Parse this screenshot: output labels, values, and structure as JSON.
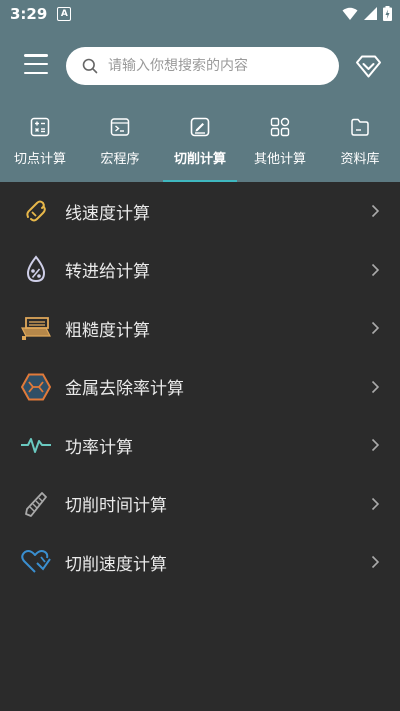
{
  "status": {
    "time": "3:29",
    "notification": "A"
  },
  "search": {
    "placeholder": "请输入你想搜索的内容"
  },
  "tabs": [
    {
      "label": "切点计算",
      "icon": "calculator-icon"
    },
    {
      "label": "宏程序",
      "icon": "terminal-icon"
    },
    {
      "label": "切削计算",
      "icon": "edit-note-icon",
      "active": true
    },
    {
      "label": "其他计算",
      "icon": "grid-apps-icon"
    },
    {
      "label": "资料库",
      "icon": "folder-icon"
    }
  ],
  "items": [
    {
      "label": "线速度计算",
      "icon": "line-speed-icon"
    },
    {
      "label": "转进给计算",
      "icon": "feed-drop-icon"
    },
    {
      "label": "粗糙度计算",
      "icon": "roughness-icon"
    },
    {
      "label": "金属去除率计算",
      "icon": "metal-removal-icon"
    },
    {
      "label": "功率计算",
      "icon": "power-wave-icon"
    },
    {
      "label": "切削时间计算",
      "icon": "cutting-time-icon"
    },
    {
      "label": "切削速度计算",
      "icon": "cutting-speed-icon"
    }
  ],
  "colors": {
    "header": "#5d7a82",
    "background": "#2b2b2b",
    "accent": "#3fb8c0"
  }
}
